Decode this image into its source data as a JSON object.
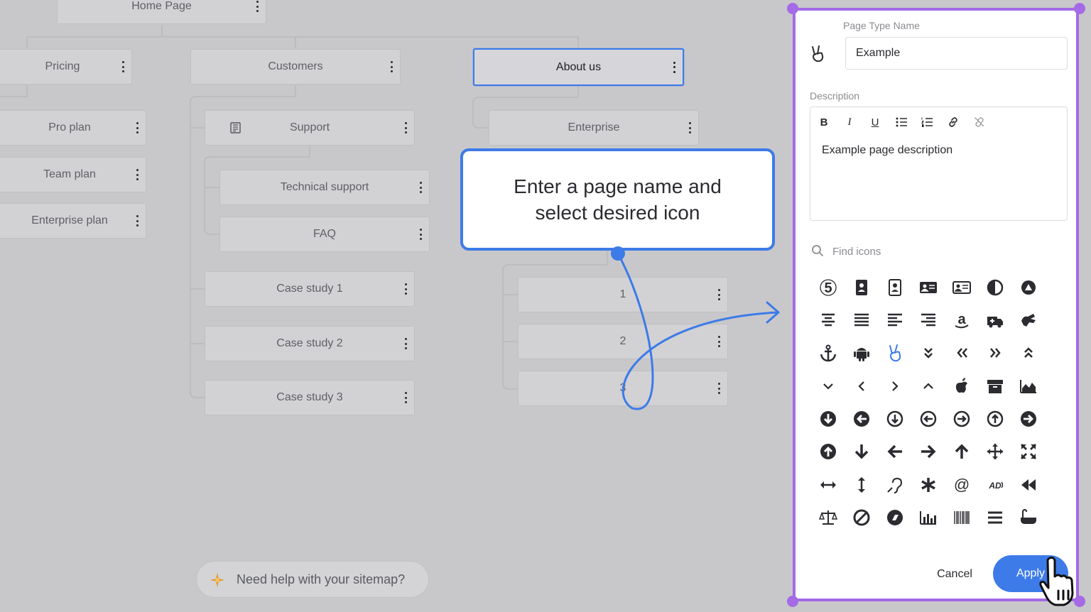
{
  "sitemap": {
    "nodes": [
      {
        "id": "home",
        "label": "Home Page"
      },
      {
        "id": "pricing",
        "label": "Pricing"
      },
      {
        "id": "pro",
        "label": "Pro plan"
      },
      {
        "id": "team",
        "label": "Team plan"
      },
      {
        "id": "enterprise-plan",
        "label": "Enterprise plan"
      },
      {
        "id": "customers",
        "label": "Customers"
      },
      {
        "id": "support",
        "label": "Support"
      },
      {
        "id": "technical",
        "label": "Technical support"
      },
      {
        "id": "faq",
        "label": "FAQ"
      },
      {
        "id": "case1",
        "label": "Case study 1"
      },
      {
        "id": "case2",
        "label": "Case study 2"
      },
      {
        "id": "case3",
        "label": "Case study 3"
      },
      {
        "id": "about",
        "label": "About us",
        "selected": true
      },
      {
        "id": "enterprise",
        "label": "Enterprise"
      },
      {
        "id": "n1",
        "label": "1"
      },
      {
        "id": "n2",
        "label": "2"
      },
      {
        "id": "n3",
        "label": "3"
      }
    ]
  },
  "callout": {
    "text": "Enter a page name and select desired icon"
  },
  "help": {
    "text": "Need help with your sitemap?"
  },
  "panel": {
    "page_type_label": "Page Type Name",
    "page_type_value": "Example",
    "selected_icon": "victory-hand-icon",
    "description_label": "Description",
    "description_text": "Example page description",
    "toolbar": [
      "bold",
      "italic",
      "underline",
      "bullet-list",
      "numbered-list",
      "link",
      "unlink"
    ],
    "search_placeholder": "Find icons",
    "icons": [
      "500px",
      "address-book",
      "address-card-outline",
      "id-card",
      "id-card-outline",
      "adjust",
      "adn",
      "align-center",
      "align-justify",
      "align-left",
      "align-right",
      "amazon",
      "ambulance",
      "american-sign-language",
      "anchor",
      "android",
      "victory-hand",
      "angle-double-down",
      "angle-double-left",
      "angle-double-right",
      "angle-double-up",
      "angle-down",
      "angle-left",
      "angle-right",
      "angle-up",
      "apple",
      "archive",
      "area-chart",
      "arrow-circle-down",
      "arrow-circle-left",
      "arrow-circle-down-outline",
      "arrow-circle-left-outline",
      "arrow-circle-right-outline",
      "arrow-circle-up-outline",
      "arrow-circle-right",
      "arrow-circle-up",
      "arrow-down",
      "arrow-left",
      "arrow-right",
      "arrow-up",
      "arrows",
      "expand",
      "arrows-horizontal",
      "arrows-vertical",
      "assistive-listening",
      "asterisk",
      "at",
      "audio-description",
      "backward",
      "balance-scale",
      "ban",
      "bandcamp",
      "bar-chart",
      "barcode",
      "bars",
      "bath"
    ],
    "cancel_label": "Cancel",
    "apply_label": "Apply"
  },
  "colors": {
    "accent": "#3d7be8",
    "panel_border": "#a56ae6",
    "icon": "#2b2b30",
    "selected_icon": "#3d7be8"
  }
}
